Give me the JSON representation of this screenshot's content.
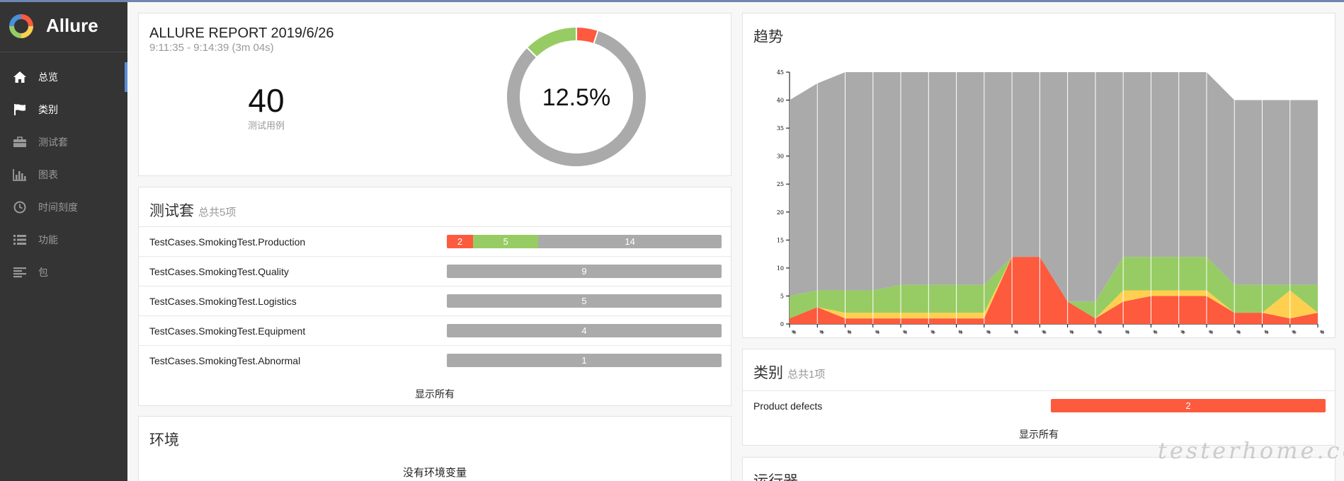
{
  "app": {
    "name": "Allure"
  },
  "sidebar": {
    "items": [
      {
        "label": "总览",
        "icon": "home-icon"
      },
      {
        "label": "类别",
        "icon": "flag-icon"
      },
      {
        "label": "测试套",
        "icon": "briefcase-icon"
      },
      {
        "label": "图表",
        "icon": "bar-chart-icon"
      },
      {
        "label": "时间刻度",
        "icon": "clock-icon"
      },
      {
        "label": "功能",
        "icon": "list-icon"
      },
      {
        "label": "包",
        "icon": "align-left-icon"
      }
    ]
  },
  "summary": {
    "title": "ALLURE REPORT 2019/6/26",
    "time": "9:11:35 - 9:14:39 (3m 04s)",
    "count": "40",
    "count_label": "测试用例",
    "percent": "12.5%",
    "donut": {
      "failed": 2,
      "passed": 5,
      "unknown": 33
    }
  },
  "suites": {
    "title": "测试套",
    "subtitle": "总共5项",
    "rows": [
      {
        "name": "TestCases.SmokingTest.Production",
        "failed": 2,
        "passed": 5,
        "unknown": 14
      },
      {
        "name": "TestCases.SmokingTest.Quality",
        "failed": 0,
        "passed": 0,
        "unknown": 9
      },
      {
        "name": "TestCases.SmokingTest.Logistics",
        "failed": 0,
        "passed": 0,
        "unknown": 5
      },
      {
        "name": "TestCases.SmokingTest.Equipment",
        "failed": 0,
        "passed": 0,
        "unknown": 4
      },
      {
        "name": "TestCases.SmokingTest.Abnormal",
        "failed": 0,
        "passed": 0,
        "unknown": 1
      }
    ],
    "show_all": "显示所有"
  },
  "environment": {
    "title": "环境",
    "empty": "没有环境变量"
  },
  "trend": {
    "title": "趋势"
  },
  "categories": {
    "title": "类别",
    "subtitle": "总共1项",
    "rows": [
      {
        "name": "Product defects",
        "value": "2"
      }
    ],
    "show_all": "显示所有"
  },
  "executors": {
    "title": "运行器"
  },
  "watermark": "testerhome.com",
  "colors": {
    "failed": "#fd5a3e",
    "passed": "#97cc64",
    "broken": "#ffd050",
    "unknown": "#aaaaaa",
    "sidebar": "#343434"
  },
  "chart_data": {
    "type": "area",
    "title": "趋势",
    "x": [
      "#150",
      "#151",
      "#152",
      "#153",
      "#155",
      "#156",
      "#157",
      "#158",
      "#159",
      "#160",
      "#161",
      "#162",
      "#163",
      "#164",
      "#165",
      "#166",
      "#168",
      "#169",
      "#170",
      "#171"
    ],
    "yticks": [
      0,
      5,
      10,
      15,
      20,
      25,
      30,
      35,
      40,
      45
    ],
    "ylim": [
      0,
      45
    ],
    "stacked": true,
    "series": [
      {
        "key": "failed",
        "values": [
          1,
          3,
          1,
          1,
          1,
          1,
          1,
          1,
          12,
          12,
          4,
          1,
          4,
          5,
          5,
          5,
          2,
          2,
          1,
          2
        ]
      },
      {
        "key": "broken",
        "values": [
          0,
          0,
          1,
          1,
          1,
          1,
          1,
          1,
          0,
          0,
          0,
          0,
          2,
          1,
          1,
          1,
          0,
          0,
          5,
          0
        ]
      },
      {
        "key": "passed",
        "values": [
          4,
          3,
          4,
          4,
          5,
          5,
          5,
          5,
          0,
          0,
          0,
          3,
          6,
          6,
          6,
          6,
          5,
          5,
          1,
          5
        ]
      },
      {
        "key": "unknown",
        "values": [
          35,
          37,
          39,
          39,
          38,
          38,
          38,
          38,
          33,
          33,
          41,
          41,
          33,
          33,
          33,
          33,
          33,
          33,
          33,
          33
        ]
      }
    ]
  }
}
